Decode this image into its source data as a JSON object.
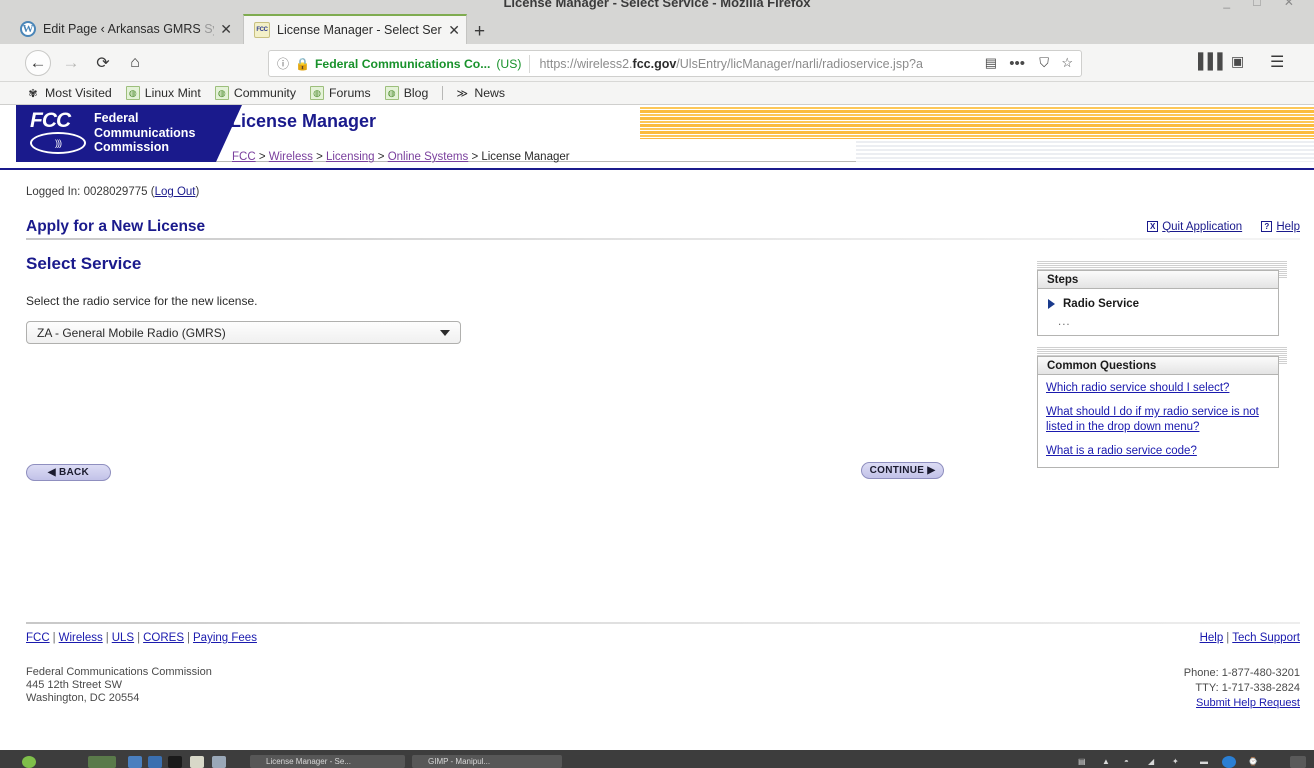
{
  "window": {
    "title": "License Manager - Select Service - Mozilla Firefox",
    "controls": "_ □ ✕"
  },
  "browser": {
    "tabs": [
      {
        "title": "Edit Page ‹ Arkansas GMRS ",
        "title_faded": "Sy",
        "favicon": "wordpress-icon",
        "favicon_text": "W",
        "active": false,
        "close": "✕"
      },
      {
        "title": "License Manager - Select Ser",
        "title_faded": "",
        "favicon": "fcc-icon",
        "favicon_text": "FCC",
        "active": true,
        "close": "✕"
      }
    ],
    "new_tab_label": "+",
    "nav": {
      "back": "←",
      "forward": "→",
      "reload": "⟳",
      "home": "⌂",
      "library": "▌▌▌",
      "sidebar": "▣",
      "menu": "☰"
    },
    "urlbar": {
      "info_icon": "ⓘ",
      "lock_icon": "🔒",
      "organization": "Federal Communications Co...",
      "country": "(US)",
      "url_prefix": "https://wireless2.",
      "url_domain": "fcc.gov",
      "url_path": "/UlsEntry/licManager/narli/radioservice.jsp?a",
      "reader_icon": "▤",
      "dots_icon": "•••",
      "pocket_icon": "⛉",
      "star_icon": "☆"
    },
    "bookmarks": [
      {
        "label": "Most Visited",
        "icon": "gear-icon",
        "glyph": "✾"
      },
      {
        "label": "Linux Mint",
        "icon": "mint-icon",
        "glyph": "◍"
      },
      {
        "label": "Community",
        "icon": "mint-icon",
        "glyph": "◍"
      },
      {
        "label": "Forums",
        "icon": "mint-icon",
        "glyph": "◍"
      },
      {
        "label": "Blog",
        "icon": "mint-icon",
        "glyph": "◍"
      },
      {
        "label": "News",
        "icon": "rss-icon",
        "glyph": "≫"
      }
    ]
  },
  "banner": {
    "logo_mark": "FCC",
    "logo_wave": "((( ○ )))",
    "org_line1": "Federal",
    "org_line2": "Communications",
    "org_line3": "Commission",
    "app_title": "License Manager",
    "breadcrumb": [
      {
        "label": "FCC",
        "link": true
      },
      {
        "label": "Wireless",
        "link": true
      },
      {
        "label": "Licensing",
        "link": true
      },
      {
        "label": "Online Systems",
        "link": true
      },
      {
        "label": "License Manager",
        "link": false
      }
    ],
    "breadcrumb_sep": ">"
  },
  "session": {
    "logged_in_prefix": "Logged In: ",
    "account": "0028029775",
    "logout_label": "Log Out"
  },
  "page": {
    "apply_title": "Apply for a New License",
    "quit_label": "Quit Application",
    "quit_icon_glyph": "X",
    "help_label": "Help",
    "help_icon_glyph": "?",
    "section_title": "Select Service",
    "instruction": "Select the radio service for the new license.",
    "service_select": {
      "value": "ZA - General Mobile Radio (GMRS)",
      "arrow": "▼"
    },
    "back_button": "◀ BACK",
    "continue_button": "CONTINUE ▶"
  },
  "steps_panel": {
    "header": "Steps",
    "items": [
      {
        "label": "Radio Service",
        "current": true
      },
      {
        "label": "...",
        "current": false
      }
    ]
  },
  "common_questions": {
    "header": "Common Questions",
    "questions": [
      "Which radio service should I select?",
      "What should I do if my radio service is not listed in the drop down menu?",
      "What is a radio service code?"
    ]
  },
  "footer": {
    "links": [
      "FCC",
      "Wireless",
      "ULS",
      "CORES",
      "Paying Fees"
    ],
    "separator": "|",
    "address_line1": "Federal Communications Commission",
    "address_line2": "445 12th Street SW",
    "address_line3": "Washington, DC 20554",
    "help_links": [
      "Help",
      "Tech Support"
    ],
    "phone": "Phone: 1-877-480-3201",
    "tty": "TTY: 1-717-338-2824",
    "submit_help": "Submit Help Request"
  },
  "taskbar": {
    "windows": [
      {
        "label": "License Manager - Se..."
      },
      {
        "label": "GIMP - Manipul..."
      }
    ]
  },
  "colors": {
    "fcc_blue": "#1a1a8c",
    "banner_gold": "#fbbc3f",
    "link_blue": "#1a1aae",
    "visited_purple": "#7a3f9d",
    "secure_green": "#18922b"
  }
}
